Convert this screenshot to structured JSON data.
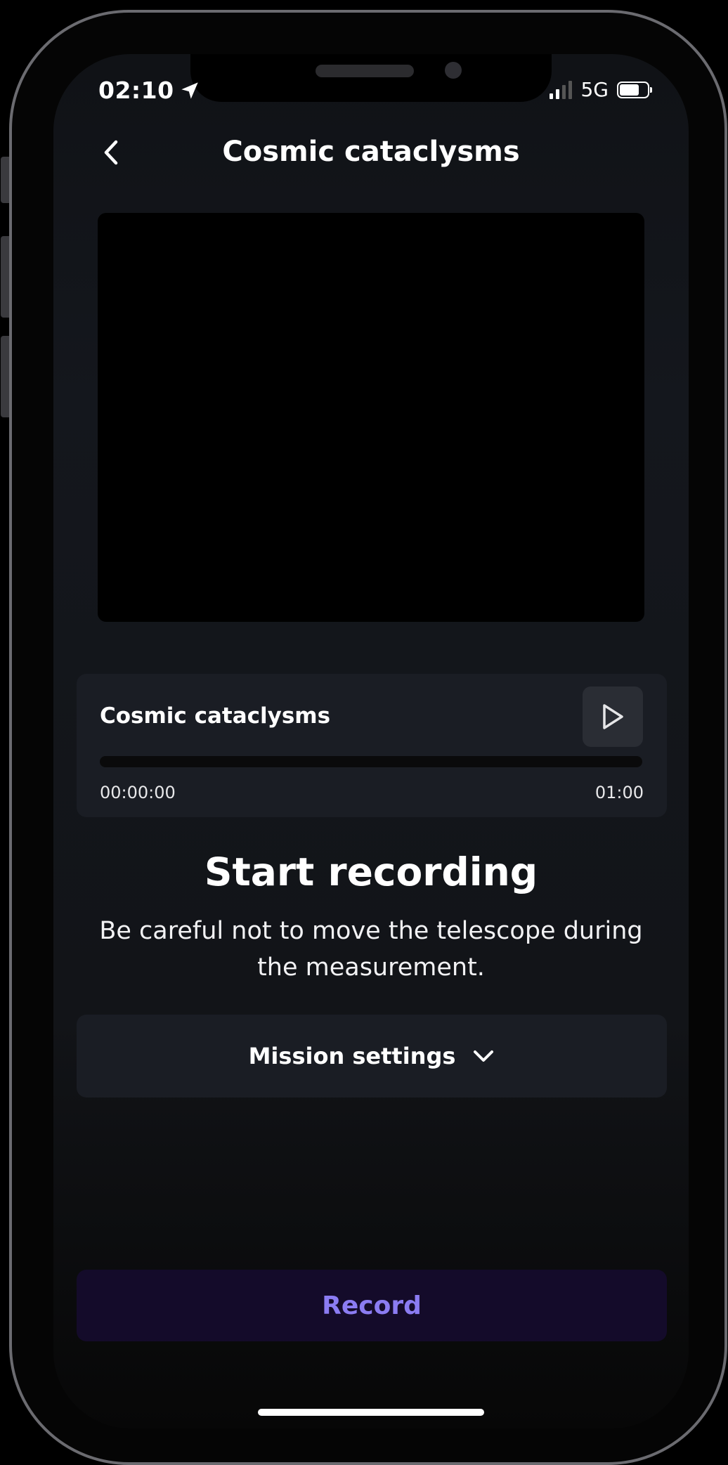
{
  "status_bar": {
    "time": "02:10",
    "network": "5G",
    "battery_level": 0.72
  },
  "header": {
    "title": "Cosmic cataclysms"
  },
  "player": {
    "title": "Cosmic cataclysms",
    "elapsed": "00:00:00",
    "duration": "01:00",
    "progress": 0
  },
  "instructions": {
    "title": "Start recording",
    "body": "Be careful not to move the telescope during the measurement."
  },
  "mission_settings": {
    "label": "Mission settings"
  },
  "record": {
    "label": "Record"
  },
  "colors": {
    "accent": "#8b7cf2",
    "record_bg": "#140b2a",
    "card_bg": "#1a1d24"
  }
}
